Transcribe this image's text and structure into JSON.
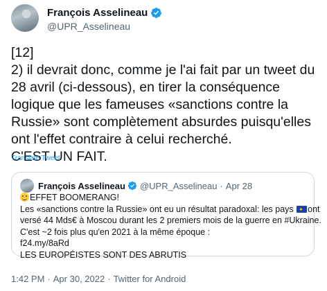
{
  "author": {
    "name": "François Asselineau",
    "handle": "@UPR_Asselineau"
  },
  "tweet": {
    "text": "[12]\n2) il devrait donc, comme je l'ai fait par un tweet du 28 avril (ci-dessous), en tirer la conséquence logique que les fameuses «sanctions contre la Russie» sont complètement absurdes puisqu'elles ont l'effet contraire à celui recherché.\nC'EST UN FAIT.",
    "translate_label": "Translate Tweet"
  },
  "quote": {
    "name": "François Asselineau",
    "handle": "@UPR_Asselineau",
    "separator": "·",
    "date": "Apr 28",
    "line1": "EFFET BOOMERANG!",
    "line2a": "Les «sanctions contre la Russie» ont eu un résultat paradoxal: les pays ",
    "line2b": "ont",
    "line3": "versé 44 Mds€ à Moscou durant les 2 premiers mois de la guerre en #Ukraine.",
    "line4": "C'est ~2 fois plus qu'en 2021 à la même époque :",
    "line5": "f24.my/8aRd",
    "line6": "LES EUROPÉISTES SONT DES ABRUTIS"
  },
  "meta": {
    "time": "1:42 PM",
    "separator": "·",
    "date": "Apr 30, 2022",
    "source": "Twitter for Android"
  },
  "colors": {
    "accent": "#1d9bf0",
    "muted": "#536471",
    "border": "#cfd9de"
  },
  "icons": {
    "verified": "verified-badge-icon",
    "emoji": "grinning-sweat-emoji-icon",
    "flag": "eu-flag-icon"
  }
}
